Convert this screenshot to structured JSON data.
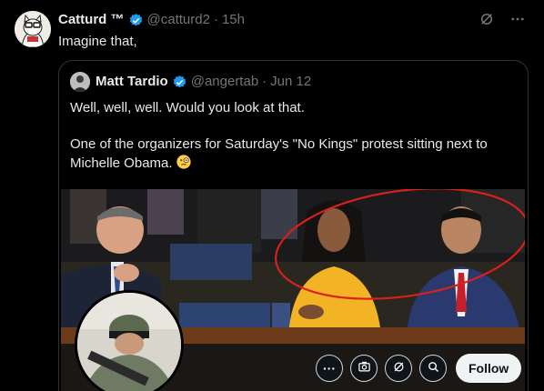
{
  "tweet": {
    "author_name": "Catturd ™",
    "author_handle": "@catturd2",
    "time": "15h",
    "text": "Imagine that,",
    "separator": "·"
  },
  "quote": {
    "author_name": "Matt Tardio",
    "author_handle": "@angertab",
    "date": "Jun 12",
    "separator": "·",
    "line1": "Well, well, well. Would you look at that.",
    "line2": "One of the organizers for Saturday's \"No Kings\" protest sitting next to Michelle Obama."
  },
  "media_actions": {
    "more_label": "···",
    "follow_label": "Follow"
  },
  "colors": {
    "verified_blue": "#1d9bf0",
    "muted": "#71767b",
    "annotation_red": "#d9201b",
    "dress_yellow": "#f2b324"
  },
  "icons": [
    "verified-badge-icon",
    "grok-icon",
    "more-icon",
    "camera-icon",
    "search-icon",
    "emoji-face-icon"
  ]
}
